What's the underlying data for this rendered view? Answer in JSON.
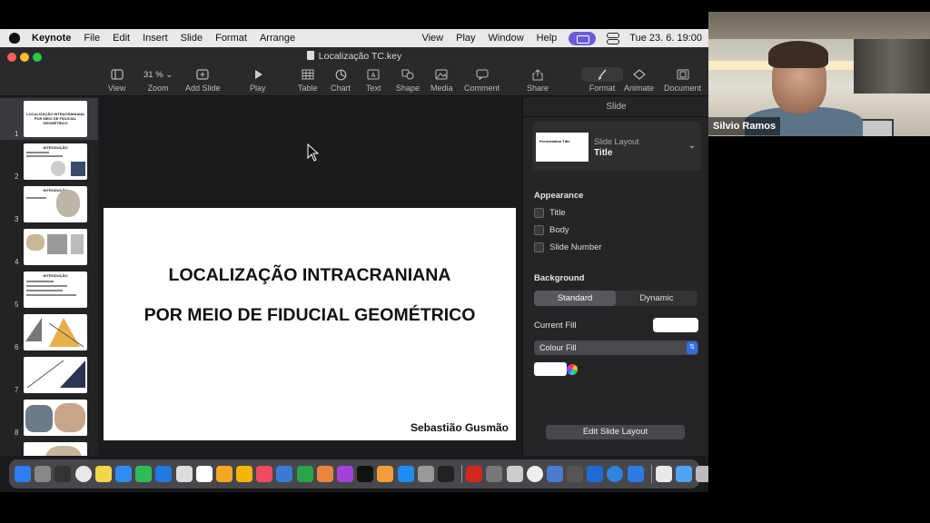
{
  "menubar": {
    "app_name": "Keynote",
    "menus": [
      "File",
      "Edit",
      "Insert",
      "Slide",
      "Format",
      "Arrange",
      "View",
      "Play",
      "Window",
      "Help"
    ],
    "datetime": "Tue 23. 6.  19:00"
  },
  "window": {
    "document_title": "Localização TC.key"
  },
  "toolbar": {
    "view": "View",
    "zoom_value": "31 %",
    "zoom": "Zoom",
    "add_slide": "Add Slide",
    "play": "Play",
    "table": "Table",
    "chart": "Chart",
    "text": "Text",
    "shape": "Shape",
    "media": "Media",
    "comment": "Comment",
    "share": "Share",
    "format": "Format",
    "animate": "Animate",
    "document": "Document"
  },
  "navigator": {
    "slides": [
      {
        "num": "1",
        "title": "LOCALIZAÇÃO INTRACRANIANA POR MEIO DE FIDUCIAL GEOMÉTRICO"
      },
      {
        "num": "2",
        "title": "INTRODUÇÃO"
      },
      {
        "num": "3",
        "title": "INTRODUÇÃO"
      },
      {
        "num": "4",
        "title": ""
      },
      {
        "num": "5",
        "title": "INTRODUÇÃO"
      },
      {
        "num": "6",
        "title": ""
      },
      {
        "num": "7",
        "title": ""
      },
      {
        "num": "8",
        "title": ""
      }
    ]
  },
  "slide": {
    "line1": "LOCALIZAÇÃO INTRACRANIANA",
    "line2": "POR MEIO DE FIDUCIAL GEOMÉTRICO",
    "author": "Sebastião Gusmão"
  },
  "inspector": {
    "header": "Slide",
    "layout_thumb_title": "Presentation Title",
    "layout_label": "Slide Layout",
    "layout_value": "Title",
    "appearance": "Appearance",
    "check_title": "Title",
    "check_body": "Body",
    "check_slide_number": "Slide Number",
    "background": "Background",
    "bg_standard": "Standard",
    "bg_dynamic": "Dynamic",
    "current_fill": "Current Fill",
    "fill_type": "Colour Fill",
    "edit_layout": "Edit Slide Layout"
  },
  "video": {
    "participant_name": "Silvio Ramos"
  },
  "colors": {
    "accent": "#6b5cd6",
    "select_blue": "#2f6fe0"
  }
}
